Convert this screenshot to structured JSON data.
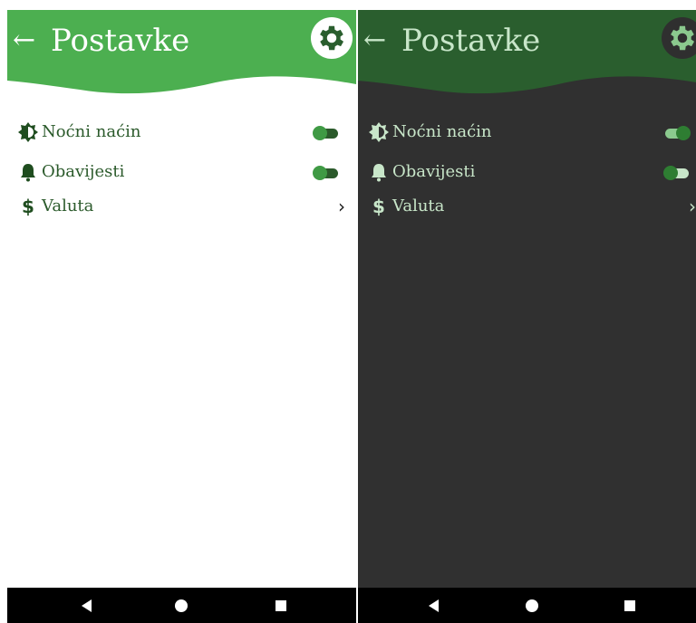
{
  "screens": [
    {
      "theme": "light",
      "back_glyph": "←",
      "title": "Postavke",
      "settings_icon": "gear-icon",
      "rows": [
        {
          "icon": "night-mode-icon",
          "label": "Noćni naćin",
          "control": "toggle",
          "on": false
        },
        {
          "icon": "bell-icon",
          "label": "Obavijesti",
          "control": "toggle",
          "on": false
        },
        {
          "icon": "dollar-icon",
          "label": "Valuta",
          "control": "chevron",
          "chevron": "›"
        }
      ]
    },
    {
      "theme": "dark",
      "back_glyph": "←",
      "title": "Postavke",
      "settings_icon": "gear-icon",
      "rows": [
        {
          "icon": "night-mode-icon",
          "label": "Noćni naćin",
          "control": "toggle",
          "on": true
        },
        {
          "icon": "bell-icon",
          "label": "Obavijesti",
          "control": "toggle",
          "on": false
        },
        {
          "icon": "dollar-icon",
          "label": "Valuta",
          "control": "chevron",
          "chevron": "›"
        }
      ]
    }
  ],
  "colors": {
    "light_header": "#4caf50",
    "dark_header": "#2a5e2e",
    "dark_background": "#303030",
    "toggle_green": "#3f9a44",
    "dark_text": "#c8e6c9",
    "light_text": "#2b5a2b"
  },
  "navbar": {
    "icons": [
      "back-triangle-icon",
      "home-circle-icon",
      "recents-square-icon"
    ]
  }
}
